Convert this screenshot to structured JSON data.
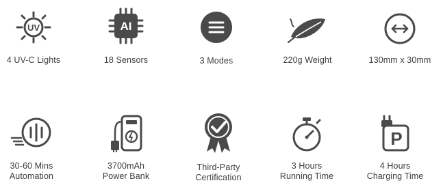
{
  "colors": {
    "icon": "#4a4a4a",
    "text": "#3d3d3d",
    "background": "#ffffff"
  },
  "features": [
    {
      "icon": "uv-sun-icon",
      "lines": [
        "4 UV-C Lights"
      ]
    },
    {
      "icon": "ai-chip-icon",
      "lines": [
        "18 Sensors"
      ]
    },
    {
      "icon": "menu-circle-icon",
      "lines": [
        "3 Modes"
      ]
    },
    {
      "icon": "feather-icon",
      "lines": [
        "220g Weight"
      ]
    },
    {
      "icon": "width-arrows-icon",
      "lines": [
        "130mm x 30mm"
      ]
    },
    {
      "icon": "automation-timer-icon",
      "lines": [
        "30-60 Mins",
        "Automation"
      ]
    },
    {
      "icon": "power-bank-icon",
      "lines": [
        "3700mAh",
        "Power Bank"
      ]
    },
    {
      "icon": "certification-badge-icon",
      "lines": [
        "Third-Party",
        "Certification"
      ]
    },
    {
      "icon": "stopwatch-icon",
      "lines": [
        "3 Hours",
        "Running Time"
      ]
    },
    {
      "icon": "charging-plug-icon",
      "lines": [
        "4 Hours",
        "Charging Time"
      ]
    }
  ],
  "icon_text": {
    "uv": "UV",
    "ai": "AI",
    "parking": "P"
  }
}
